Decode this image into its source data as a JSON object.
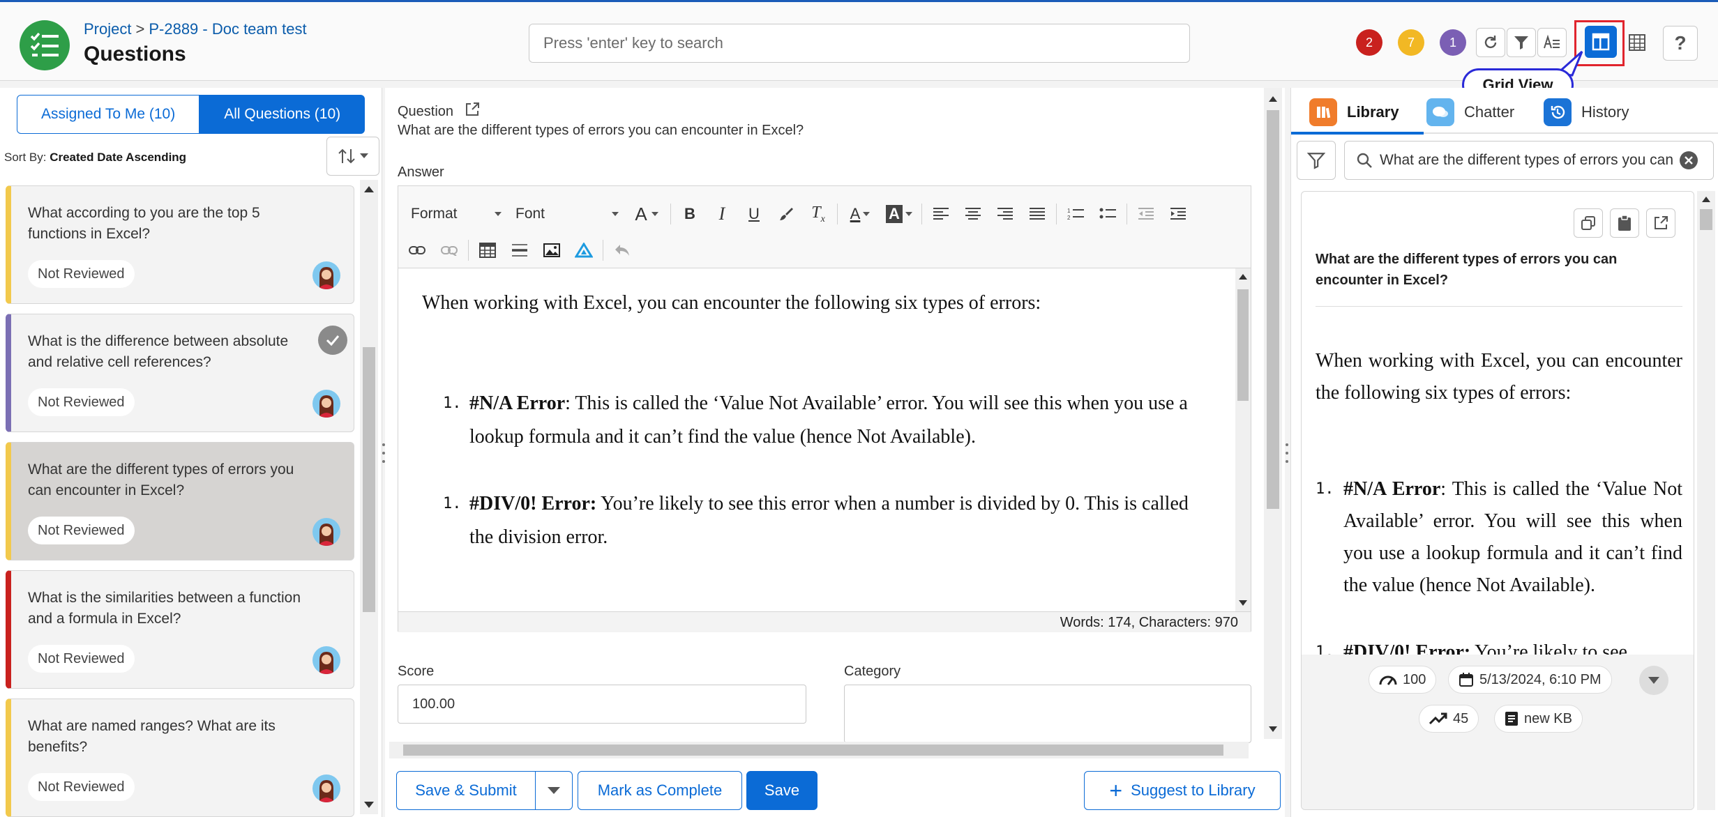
{
  "header": {
    "breadcrumb_project": "Project",
    "breadcrumb_sep": ">",
    "breadcrumb_item": "P-2889 - Doc team test",
    "title": "Questions",
    "search_placeholder": "Press 'enter' key to search",
    "badges": [
      {
        "count": "2",
        "color": "#c9211e"
      },
      {
        "count": "7",
        "color": "#f2b824"
      },
      {
        "count": "1",
        "color": "#7b5fb4"
      }
    ],
    "tooltip": "Grid View"
  },
  "left": {
    "tab_assigned": "Assigned To Me (10)",
    "tab_all": "All Questions (10)",
    "sort_prefix": "Sort By:",
    "sort_value": "Created Date Ascending",
    "questions": [
      {
        "text": "What according to you are the top 5 functions in Excel?",
        "status": "Not Reviewed",
        "accent": "#f2c94c"
      },
      {
        "text": "What is the difference between absolute and relative cell references?",
        "status": "Not Reviewed",
        "accent": "#7b6fb4"
      },
      {
        "text": "What are the different types of errors you can encounter in Excel?",
        "status": "Not Reviewed",
        "accent": "#f2c94c"
      },
      {
        "text": "What is the similarities between a function and a formula in Excel?",
        "status": "Not Reviewed",
        "accent": "#c9211e"
      },
      {
        "text": "What are named ranges? What are its benefits?",
        "status": "Not Reviewed",
        "accent": "#f2c94c"
      }
    ]
  },
  "middle": {
    "question_label": "Question",
    "question_text": "What are the different types of errors you can encounter in Excel?",
    "answer_label": "Answer",
    "format_label": "Format",
    "font_label": "Font",
    "answer_intro": "When working with Excel, you can encounter the following six types of errors:",
    "item1_num": "1.",
    "item1_bold": "#N/A Error",
    "item1_text": ": This is called the ‘Value Not Available’ error. You will see this when you use a lookup formula and it can’t find the value (hence Not Available).",
    "item2_num": "1.",
    "item2_bold": "#DIV/0! Error:",
    "item2_text": " You’re likely to see this error when a number is divided by 0. This is called the division error.",
    "word_count": "Words: 174, Characters: 970",
    "score_label": "Score",
    "score_value": "100.00",
    "category_label": "Category",
    "btn_save_submit": "Save & Submit",
    "btn_mark_complete": "Mark as Complete",
    "btn_save": "Save",
    "btn_suggest": "Suggest to Library"
  },
  "right": {
    "tab_library": "Library",
    "tab_chatter": "Chatter",
    "tab_history": "History",
    "search_value": "What are the different types of errors you can encounter in Excel?",
    "kb_title": "What are the different types of errors you can encounter in Excel?",
    "kb_intro": "When working with Excel, you can encounter the following six types of errors:",
    "kb_item1_num": "1.",
    "kb_item1_bold": "#N/A Error",
    "kb_item1_text": ": This is called the ‘Value Not Available’ error. You will see this when you use a lookup formula and it can’t find the value (hence Not Available).",
    "kb_item2_num": "1.",
    "kb_item2_bold": "#DIV/0! Error:",
    "kb_item2_text": " You’re likely to see",
    "usage": "100",
    "date": "5/13/2024, 6:10 PM",
    "trend": "45",
    "kb_type": "new KB"
  }
}
